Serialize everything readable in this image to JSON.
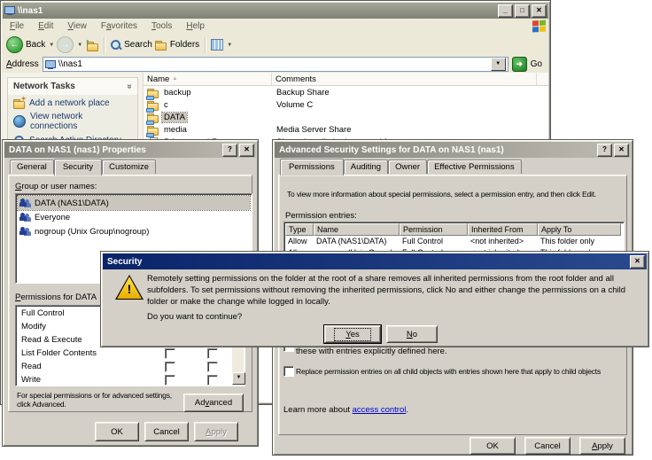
{
  "explorer": {
    "title": "\\\\nas1",
    "menu": [
      "File",
      "Edit",
      "View",
      "Favorites",
      "Tools",
      "Help"
    ],
    "toolbar": {
      "back": "Back",
      "search": "Search",
      "folders": "Folders"
    },
    "address": {
      "label": "Address",
      "value": "\\\\nas1",
      "go": "Go"
    },
    "tasks": {
      "header": "Network Tasks",
      "items": [
        "Add a network place",
        "View network connections",
        "Search Active Directory"
      ]
    },
    "list": {
      "col_name": "Name",
      "col_comments": "Comments",
      "rows": [
        {
          "name": "backup",
          "comment": "Backup Share"
        },
        {
          "name": "c",
          "comment": "Volume C"
        },
        {
          "name": "DATA",
          "comment": ""
        },
        {
          "name": "media",
          "comment": "Media Server Share"
        },
        {
          "name": "Printers and Faxes",
          "comment": "Shows installed printers and fax ..."
        }
      ]
    }
  },
  "properties": {
    "title": "DATA on NAS1 (nas1) Properties",
    "tabs": [
      "General",
      "Security",
      "Customize"
    ],
    "group_label": "Group or user names:",
    "groups": [
      "DATA (NAS1\\DATA)",
      "Everyone",
      "nogroup (Unix Group\\nogroup)"
    ],
    "perm_label": "Permissions for DATA",
    "permissions": [
      "Full Control",
      "Modify",
      "Read & Execute",
      "List Folder Contents",
      "Read",
      "Write"
    ],
    "note": "For special permissions or for advanced settings, click Advanced.",
    "advanced_button": "Advanced",
    "ok": "OK",
    "cancel": "Cancel",
    "apply": "Apply"
  },
  "advanced": {
    "title": "Advanced Security Settings for DATA on NAS1 (nas1)",
    "tabs": [
      "Permissions",
      "Auditing",
      "Owner",
      "Effective Permissions"
    ],
    "instruction": "To view more information about special permissions, select a permission entry, and then click Edit.",
    "entries_label": "Permission entries:",
    "columns": [
      "Type",
      "Name",
      "Permission",
      "Inherited From",
      "Apply To"
    ],
    "rows": [
      {
        "type": "Allow",
        "name": "DATA (NAS1\\DATA)",
        "permission": "Full Control",
        "inherited": "<not inherited>",
        "apply_to": "This folder only"
      },
      {
        "type": "Allow",
        "name": "nogroup (Unix Group\\nogroup)",
        "permission": "Full Control",
        "inherited": "<not inherited>",
        "apply_to": "This folder only"
      }
    ],
    "inherit_line2": "these with entries explicitly defined here.",
    "replace_label": "Replace permission entries on all child objects with entries shown here that apply to child objects",
    "learn_prefix": "Learn more about ",
    "learn_link": "access control",
    "learn_suffix": ".",
    "ok": "OK",
    "cancel": "Cancel",
    "apply": "Apply"
  },
  "security": {
    "title": "Security",
    "message": "Remotely setting permissions on the folder at the root of a share removes all inherited permissions from the root folder and all subfolders. To set permissions without removing the inherited permissions, click No and either change the permissions on a child folder or make the change while logged in locally.",
    "question": "Do you want to continue?",
    "yes": "Yes",
    "no": "No"
  },
  "colors": {
    "active_titlebar": "#0a246a",
    "inactive_titlebar": "#7f7f77",
    "dialog_face": "#d4d0c8",
    "go_green": "#1d7c1d",
    "link": "#0000cc"
  }
}
